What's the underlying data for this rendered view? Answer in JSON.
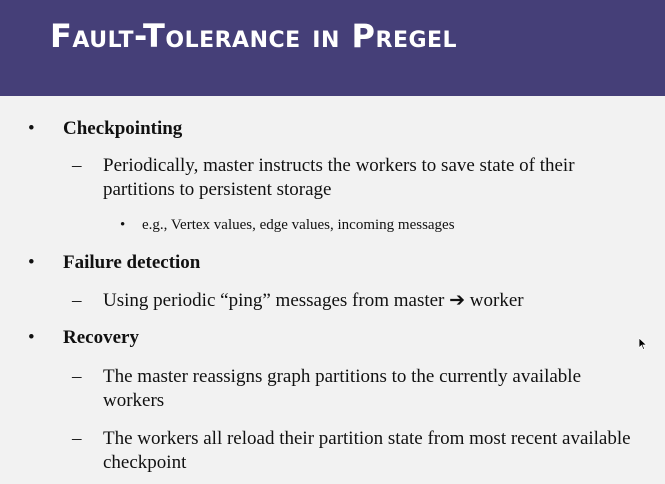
{
  "slide": {
    "title": "Fault-Tolerance in Pregel",
    "bullet_symbol": "•",
    "dash_symbol": "–",
    "sub_bullet_symbol": "•",
    "items": [
      {
        "heading": "Checkpointing",
        "sub": [
          "Periodically, master instructs the workers to save state of their partitions to persistent storage"
        ],
        "subsub": "e.g., Vertex values, edge values, incoming messages"
      },
      {
        "heading": "Failure detection",
        "sub": [
          "Using periodic “ping” messages from master ➔ worker"
        ]
      },
      {
        "heading": "Recovery",
        "sub": [
          "The master reassigns graph partitions to the currently available workers",
          "The workers all reload their partition state from most recent available checkpoint"
        ]
      }
    ]
  },
  "colors": {
    "title_bar": "#453f78",
    "title_text": "#ffffff",
    "background": "#f2f2f2"
  }
}
